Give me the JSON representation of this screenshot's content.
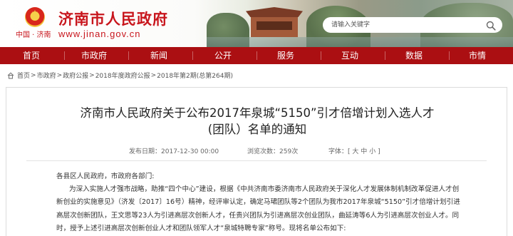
{
  "header": {
    "site_title": "济南市人民政府",
    "site_url": "www.jinan.gov.cn",
    "china_jinan": "中国 · 济南",
    "emblem_icon": "national-emblem-icon",
    "search_placeholder": "请输入关键字",
    "search_icon": "search-icon",
    "brand_color": "#ab0f12",
    "title_color": "#c8161d"
  },
  "nav": {
    "items": [
      "首页",
      "市政府",
      "新闻",
      "公开",
      "服务",
      "互动",
      "数据",
      "市情"
    ]
  },
  "breadcrumb": {
    "home_icon": "home-icon",
    "items": [
      "首页",
      "市政府",
      "政府公报",
      "2018年度政府公报",
      "2018年第2期(总第264期)"
    ],
    "separator": ">"
  },
  "article": {
    "title_line1": "济南市人民政府关于公布2017年泉城“5150”引才倍增计划入选人才",
    "title_line2": "(团队）名单的通知",
    "publish_label": "发布日期：",
    "publish_date": "2017-12-30 00:00",
    "views_label": "浏览次数：",
    "views": "259次",
    "font_label": "字体：",
    "font_bracket_open": "[",
    "font_sizes": [
      "大",
      "中",
      "小"
    ],
    "font_bracket_close": "]",
    "paragraphs": [
      "各县区人民政府，市政府各部门:",
      "为深入实施人才强市战略，助推“四个中心”建设，根据《中共济南市委济南市人民政府关于深化人才发展体制机制改革促进人才创",
      "新创业的实施意见》（济发〔2017〕16号）精神，经评审认定，确定马珺团队等2个团队为我市2017年泉城“5150”引才倍增计划引进",
      "高层次创新团队，王文思等23人为引进高层次创新人才，任贵兴团队为引进高层次创业团队，曲延涛等6人为引进高层次创业人才。同",
      "时，授予上述引进高层次创新创业人才和团队领军人才“泉城特聘专家”称号。现将名单公布如下:"
    ]
  }
}
